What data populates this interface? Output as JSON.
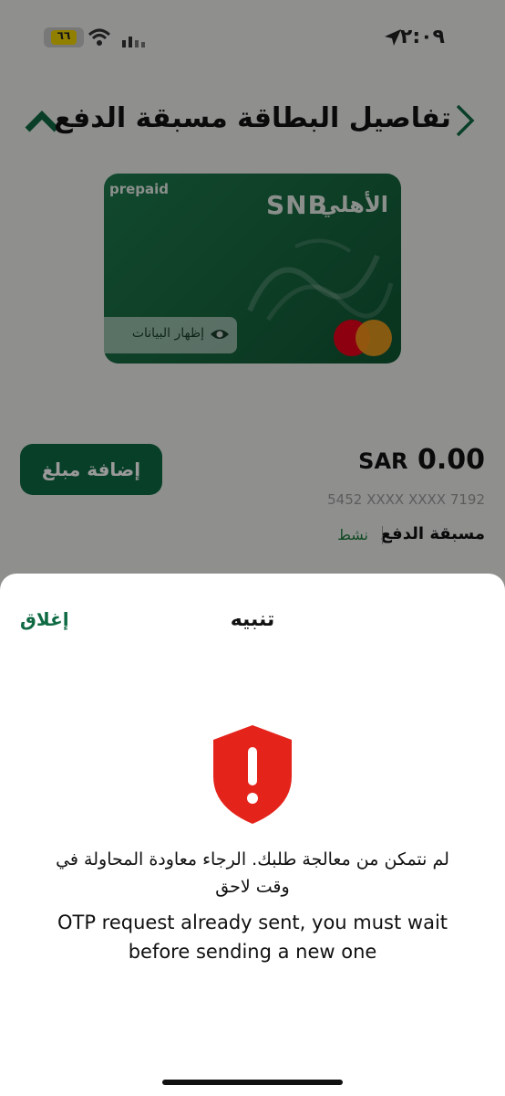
{
  "status_bar": {
    "time": "٢:٠٩",
    "battery_level": "٦٦"
  },
  "header": {
    "title": "تفاصيل البطاقة مسبقة الدفع"
  },
  "card": {
    "prepaid_label": "prepaid",
    "bank_name_ar": "الأهلي",
    "bank_name_en": "SNB",
    "show_data_label": "إظهار البيانات"
  },
  "account": {
    "balance_amount": "0.00",
    "balance_currency": "SAR",
    "card_number": "5452 XXXX XXXX 7192",
    "card_type": "مسبقة الدفع",
    "status": "نشط",
    "add_amount_label": "إضافة مبلغ"
  },
  "alert": {
    "title": "تنبيه",
    "close_label": "إغلاق",
    "message_ar": "لم نتمكن من معالجة طلبك. الرجاء معاودة المحاولة في وقت لاحق",
    "message_en": "OTP request already sent, you must wait before sending a new one"
  },
  "colors": {
    "accent": "#0f6a43",
    "danger": "#e4231b"
  }
}
